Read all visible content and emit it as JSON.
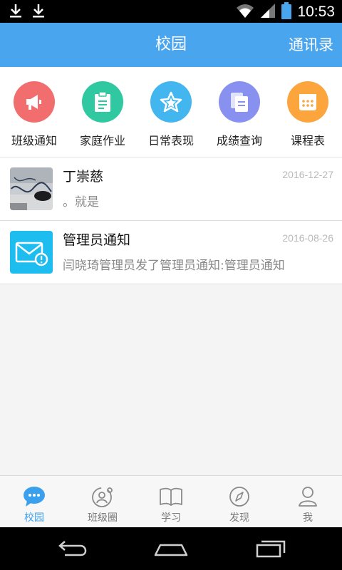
{
  "status_bar": {
    "time": "10:53",
    "icons": [
      "download-icon",
      "download-icon",
      "wifi-icon",
      "signal-icon",
      "battery-icon"
    ]
  },
  "app_bar": {
    "title": "校园",
    "action_label": "通讯录",
    "color": "#4aa5ef"
  },
  "quick_menu": [
    {
      "label": "班级通知",
      "icon": "megaphone-icon",
      "color": "#f26d6d"
    },
    {
      "label": "家庭作业",
      "icon": "clipboard-icon",
      "color": "#2fc8a0"
    },
    {
      "label": "日常表现",
      "icon": "star-icon",
      "color": "#43b6f0"
    },
    {
      "label": "成绩查询",
      "icon": "documents-icon",
      "color": "#8891ef"
    },
    {
      "label": "课程表",
      "icon": "calendar-icon",
      "color": "#fba53c"
    }
  ],
  "messages": [
    {
      "title": "丁崇慈",
      "date": "2016-12-27",
      "snippet": "。就是",
      "avatar": "photo-avatar"
    },
    {
      "title": "管理员通知",
      "date": "2016-08-26",
      "snippet": "闫晓琦管理员发了管理员通知:管理员通知",
      "avatar": "mail-alert-icon"
    }
  ],
  "tab_bar": {
    "active_color": "#3aa0ee",
    "items": [
      {
        "label": "校园",
        "icon": "chat-bubble-icon",
        "active": true
      },
      {
        "label": "班级圈",
        "icon": "class-circle-icon",
        "active": false
      },
      {
        "label": "学习",
        "icon": "book-icon",
        "active": false
      },
      {
        "label": "发现",
        "icon": "compass-icon",
        "active": false
      },
      {
        "label": "我",
        "icon": "person-icon",
        "active": false
      }
    ]
  },
  "nav_bar": {
    "buttons": [
      "back-icon",
      "home-icon",
      "recents-icon"
    ]
  }
}
